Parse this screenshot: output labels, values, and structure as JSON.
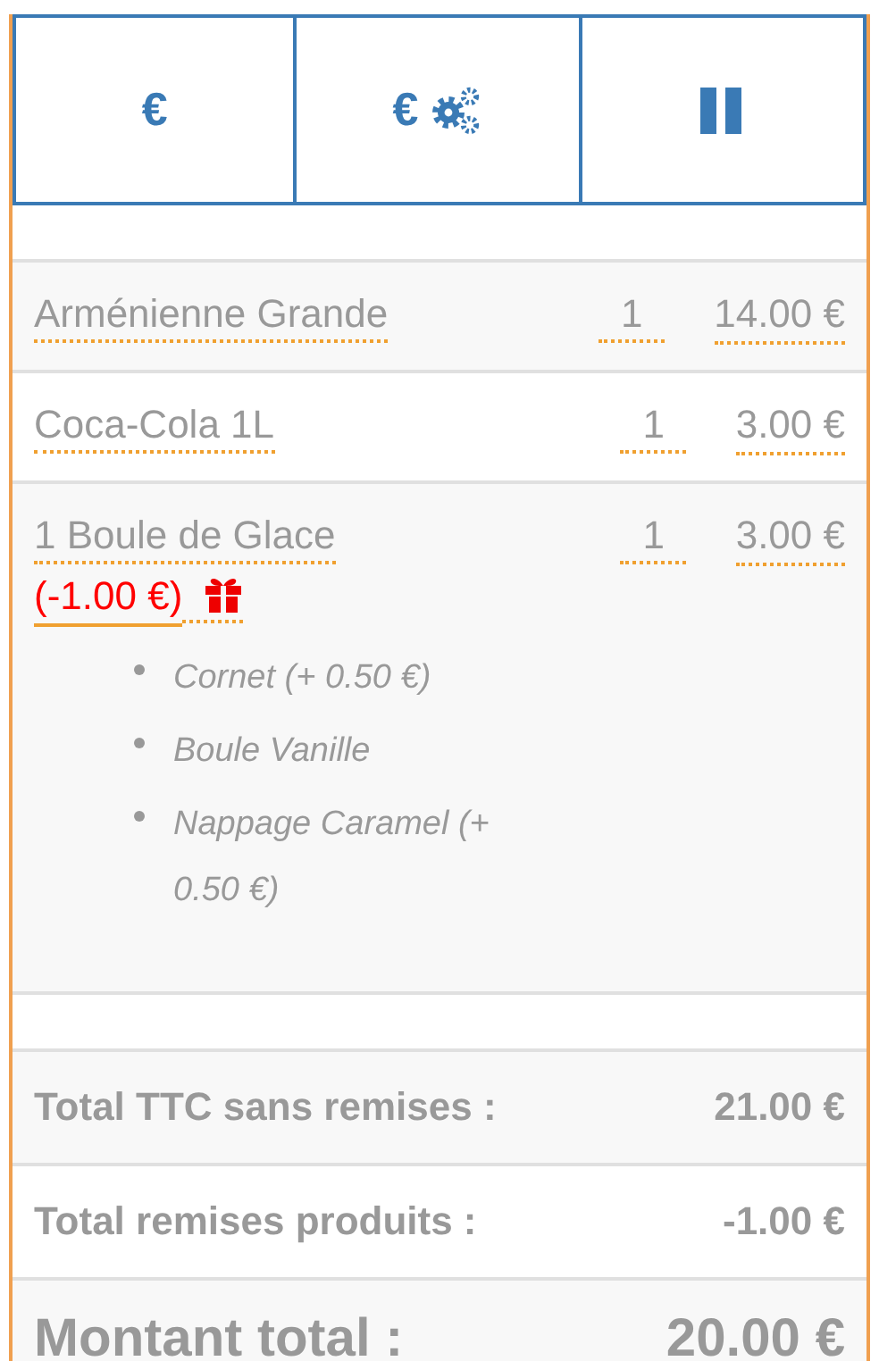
{
  "toolbar": {
    "buttons": [
      {
        "kind": "cash",
        "label": "€"
      },
      {
        "kind": "cash_settings",
        "label": "€"
      },
      {
        "kind": "pause"
      }
    ]
  },
  "items": [
    {
      "name": "Arménienne Grande",
      "quantity": "1",
      "price": "14.00 €"
    },
    {
      "name": "Coca-Cola 1L",
      "quantity": "1",
      "price": "3.00 €"
    },
    {
      "name": "1 Boule de Glace",
      "quantity": "1",
      "price": "3.00 €",
      "discount": "(-1.00 €)",
      "options": [
        "Cornet (+ 0.50 €)",
        "Boule Vanille",
        "Nappage Caramel (+ 0.50 €)"
      ]
    }
  ],
  "totals": [
    {
      "label": "Total TTC sans remises :",
      "value": "21.00 €"
    },
    {
      "label": "Total remises produits :",
      "value": "-1.00 €"
    }
  ],
  "grand_total": {
    "label": "Montant total :",
    "value": "20.00 €"
  }
}
